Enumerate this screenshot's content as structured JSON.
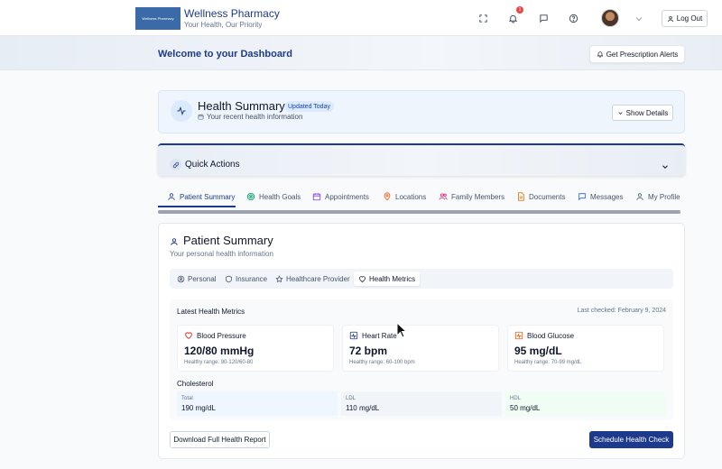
{
  "header": {
    "logo_text": "Wellness Pharmacy",
    "brand_name": "Wellness Pharmacy",
    "tagline": "Your Health, Our Priority",
    "notification_count": "1",
    "logout_label": "Log Out"
  },
  "welcome": {
    "title": "Welcome to your Dashboard",
    "rx_alerts_label": "Get Prescription Alerts"
  },
  "health_summary": {
    "title": "Health Summary",
    "badge": "Updated Today",
    "subtitle": "Your recent health information",
    "show_details_label": "Show Details"
  },
  "quick_actions": {
    "title": "Quick Actions"
  },
  "tabs": [
    {
      "label": "Patient Summary",
      "icon": "user-icon"
    },
    {
      "label": "Health Goals",
      "icon": "target-icon"
    },
    {
      "label": "Appointments",
      "icon": "calendar-icon"
    },
    {
      "label": "Locations",
      "icon": "map-pin-icon"
    },
    {
      "label": "Family Members",
      "icon": "users-icon"
    },
    {
      "label": "Documents",
      "icon": "document-icon"
    },
    {
      "label": "Messages",
      "icon": "message-icon"
    },
    {
      "label": "My Profile",
      "icon": "user-icon"
    }
  ],
  "patient_summary": {
    "title": "Patient Summary",
    "subtitle": "Your personal health information",
    "subtabs": [
      {
        "label": "Personal",
        "icon": "user-circle-icon"
      },
      {
        "label": "Insurance",
        "icon": "shield-icon"
      },
      {
        "label": "Healthcare Provider",
        "icon": "star-icon"
      },
      {
        "label": "Health Metrics",
        "icon": "heart-icon"
      }
    ],
    "latest_title": "Latest Health Metrics",
    "last_checked": "Last checked: February 9, 2024",
    "metrics": [
      {
        "name": "Blood Pressure",
        "value": "120/80 mmHg",
        "range": "Healthy range: 90-120/60-80",
        "icon": "heart-icon",
        "color": "#dc2626"
      },
      {
        "name": "Heart Rate",
        "value": "72 bpm",
        "range": "Healthy range: 60-100 bpm",
        "icon": "activity-icon",
        "color": "#1e3a8a"
      },
      {
        "name": "Blood Glucose",
        "value": "95 mg/dL",
        "range": "Healthy range: 70-99 mg/dL",
        "icon": "glucose-icon",
        "color": "#ea580c"
      }
    ],
    "cholesterol_title": "Cholesterol",
    "cholesterol": [
      {
        "label": "Total",
        "value": "190 mg/dL",
        "color": "#eff6ff"
      },
      {
        "label": "LDL",
        "value": "110 mg/dL",
        "color": "#f1f5f9"
      },
      {
        "label": "HDL",
        "value": "50 mg/dL",
        "color": "#f0fdf4"
      }
    ],
    "download_label": "Download Full Health Report",
    "schedule_label": "Schedule Health Check"
  },
  "colors": {
    "accent": "#1e3a8a",
    "danger": "#ef4444"
  }
}
